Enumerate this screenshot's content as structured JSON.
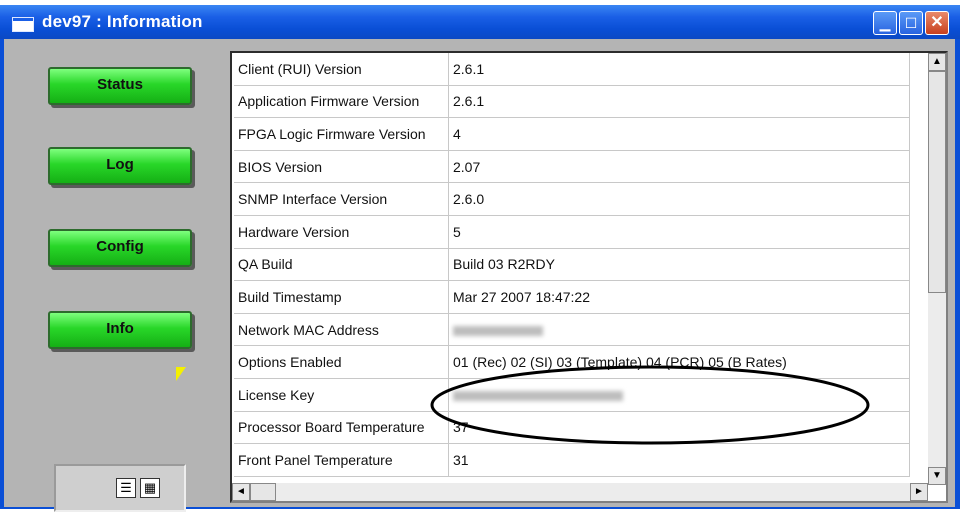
{
  "window": {
    "title": "dev97 : Information"
  },
  "nav": {
    "status": "Status",
    "log": "Log",
    "config": "Config",
    "info": "Info"
  },
  "info_rows": [
    {
      "key": "Client (RUI) Version",
      "value": "2.6.1"
    },
    {
      "key": "Application Firmware Version",
      "value": "2.6.1"
    },
    {
      "key": "FPGA Logic Firmware Version",
      "value": "4"
    },
    {
      "key": "BIOS Version",
      "value": "2.07"
    },
    {
      "key": "SNMP Interface Version",
      "value": "2.6.0"
    },
    {
      "key": "Hardware Version",
      "value": "5"
    },
    {
      "key": "QA Build",
      "value": "Build 03 R2RDY"
    },
    {
      "key": "Build Timestamp",
      "value": "Mar 27 2007 18:47:22"
    },
    {
      "key": "Network MAC Address",
      "value": ""
    },
    {
      "key": "Options Enabled",
      "value": "01 (Rec) 02 (SI) 03 (Template) 04 (PCR) 05 (B Rates)"
    },
    {
      "key": "License Key",
      "value": ""
    },
    {
      "key": "Processor Board Temperature",
      "value": "37"
    },
    {
      "key": "Front Panel Temperature",
      "value": "31"
    }
  ],
  "icons": {
    "app": "window-icon",
    "list_view": "list-view-icon",
    "grid_view": "grid-view-icon"
  }
}
